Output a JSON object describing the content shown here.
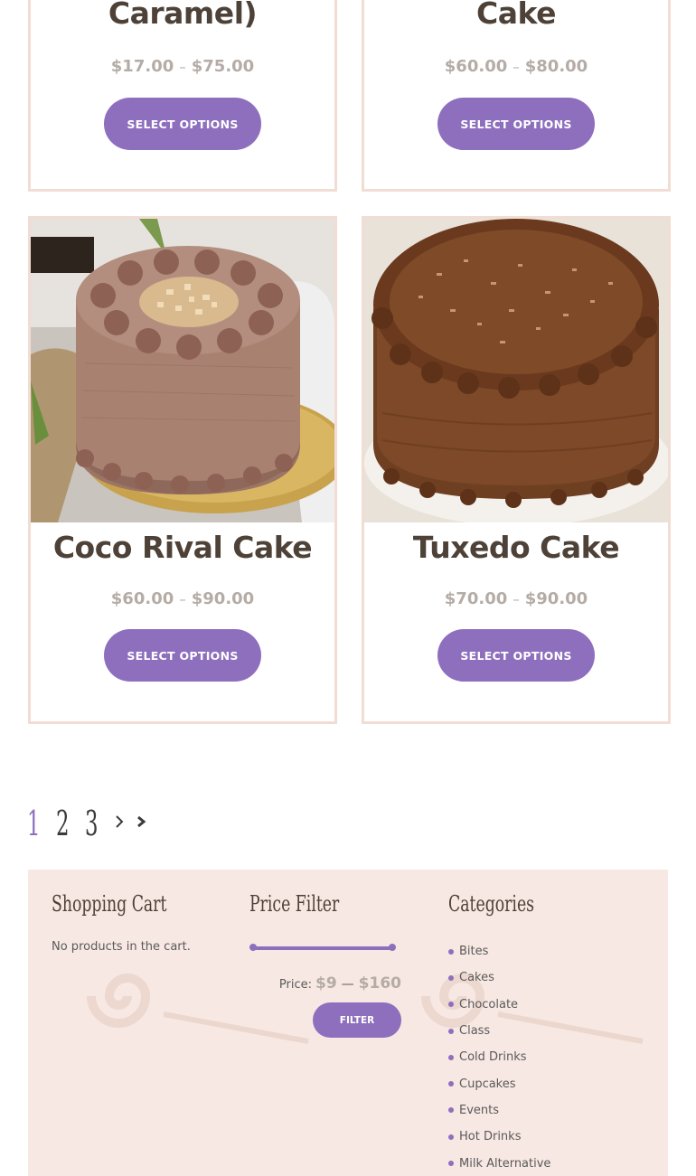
{
  "products": [
    {
      "title": "Caramel)",
      "price_min": "$17.00",
      "price_max": "$75.00",
      "price_sep": "–",
      "button_label": "SELECT OPTIONS"
    },
    {
      "title": "Cake",
      "price_min": "$60.00",
      "price_max": "$80.00",
      "price_sep": "–",
      "button_label": "SELECT OPTIONS"
    },
    {
      "title": "Coco Rival Cake",
      "price_min": "$60.00",
      "price_max": "$90.00",
      "price_sep": "–",
      "button_label": "SELECT OPTIONS"
    },
    {
      "title": "Tuxedo Cake",
      "price_min": "$70.00",
      "price_max": "$90.00",
      "price_sep": "–",
      "button_label": "SELECT OPTIONS"
    }
  ],
  "pagination": {
    "pages": [
      "1",
      "2",
      "3"
    ],
    "current": "1",
    "icons": [
      "chevron-right-icon",
      "double-chevron-right-icon"
    ]
  },
  "footer": {
    "cart": {
      "title": "Shopping Cart",
      "empty_text": "No products in the cart."
    },
    "price_filter": {
      "title": "Price Filter",
      "price_label": "Price:",
      "min": "$9",
      "sep": "—",
      "max": "$160",
      "button_label": "FILTER"
    },
    "categories": {
      "title": "Categories",
      "items": [
        "Bites",
        "Cakes",
        "Chocolate",
        "Class",
        "Cold Drinks",
        "Cupcakes",
        "Events",
        "Hot Drinks",
        "Milk Alternative"
      ]
    }
  },
  "colors": {
    "accent": "#8e6fbe",
    "card_border": "#f2ddd5",
    "footer_bg": "#f7e8e3",
    "title": "#4e4238",
    "price": "#b5aca6"
  }
}
